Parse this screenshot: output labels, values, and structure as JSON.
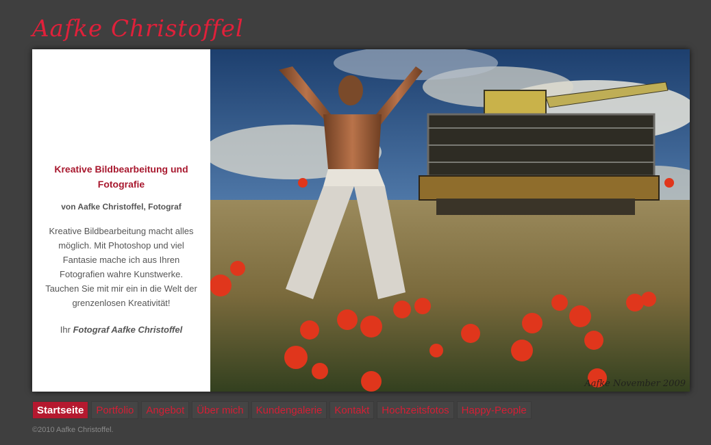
{
  "header": {
    "site_title": "Aafke Christoffel"
  },
  "intro": {
    "heading": "Kreative Bildbearbeitung und Fotografie",
    "byline": "von Aafke Christoffel, Fotograf",
    "body": "Kreative Bildbearbeitung macht alles möglich. Mit Photoshop und viel Fantasie mache ich aus Ihren Fotografien wahre Kunstwerke. Tauchen Sie mit mir ein in die Welt der grenzenlosen Kreativität!",
    "sign_prefix": "Ihr",
    "sign_name": "Fotograf Aafke Christoffel"
  },
  "hero": {
    "watermark": "Aafke November 2009"
  },
  "nav": {
    "items": [
      {
        "label": "Startseite",
        "active": true
      },
      {
        "label": "Portfolio",
        "active": false
      },
      {
        "label": "Angebot",
        "active": false
      },
      {
        "label": "Über mich",
        "active": false
      },
      {
        "label": "Kundengalerie",
        "active": false
      },
      {
        "label": "Kontakt",
        "active": false
      },
      {
        "label": "Hochzeitsfotos",
        "active": false
      },
      {
        "label": "Happy-People",
        "active": false
      }
    ]
  },
  "footer": {
    "copyright": "©2010 Aafke Christoffel."
  },
  "colors": {
    "background": "#3f3f3f",
    "accent": "#e0203a",
    "nav_active": "#b5192f"
  }
}
